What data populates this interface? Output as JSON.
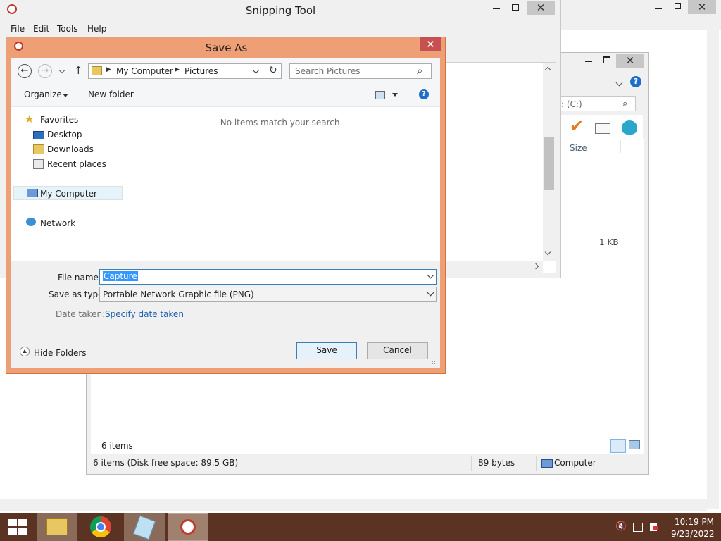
{
  "snip": {
    "title": "Snipping Tool",
    "menu": [
      "File",
      "Edit",
      "Tools",
      "Help"
    ]
  },
  "explorer": {
    "address_partial": ": (C:)",
    "column_size": "Size",
    "size_value": "1 KB",
    "item_count": "6 items",
    "status_left": "6 items (Disk free space: 89.5 GB)",
    "status_mid": "89 bytes",
    "status_right": "Computer"
  },
  "dialog": {
    "title": "Save As",
    "breadcrumb": [
      "My Computer",
      "Pictures"
    ],
    "search_placeholder": "Search Pictures",
    "organize_label": "Organize",
    "new_folder_label": "New folder",
    "empty_message": "No items match your search.",
    "nav": {
      "favorites": "Favorites",
      "desktop": "Desktop",
      "downloads": "Downloads",
      "recent": "Recent places",
      "computer": "My Computer",
      "network": "Network"
    },
    "file_name_label": "File name:",
    "file_name_value": "Capture",
    "save_type_label": "Save as type:",
    "save_type_value": "Portable Network Graphic file (PNG)",
    "date_label": "Date taken:",
    "date_link": "Specify date taken",
    "hide_folders": "Hide Folders",
    "save": "Save",
    "cancel": "Cancel"
  },
  "taskbar": {
    "time": "10:19 PM",
    "date": "9/23/2022"
  }
}
